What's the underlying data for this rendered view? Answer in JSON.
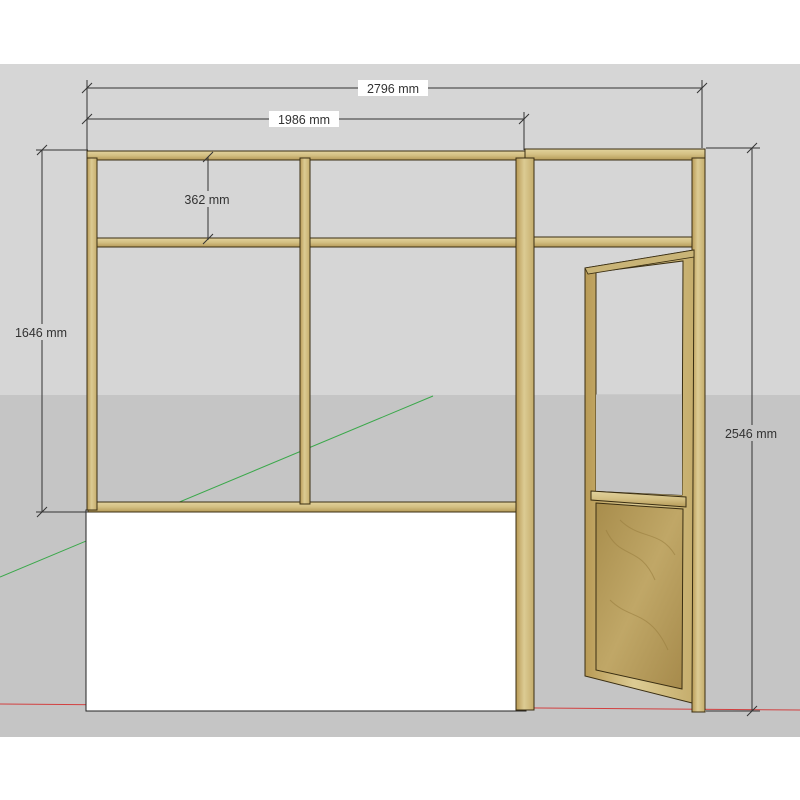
{
  "dimensions": {
    "overall_width": "2796 mm",
    "glazed_width": "1986 mm",
    "transom_height": "362 mm",
    "window_height": "1646 mm",
    "total_height": "2546 mm"
  },
  "colors": {
    "sky": "#d6d6d6",
    "ground": "#c5c5c5",
    "timber_light": "#d9c88f",
    "timber_dark": "#a88c4a",
    "door_panel": "#b59c5c",
    "panel_white": "#ffffff",
    "axis_green": "#3aa84a",
    "axis_red": "#d24040",
    "dim_line": "#333333"
  }
}
